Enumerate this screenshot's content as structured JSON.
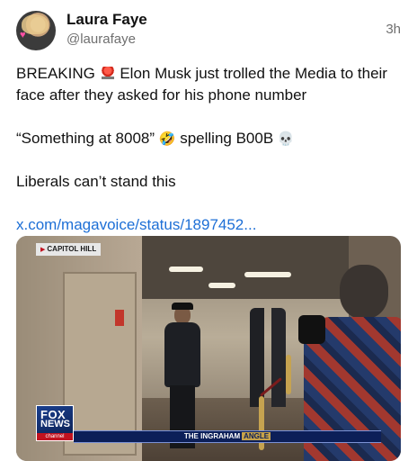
{
  "author": {
    "name": "Laura Faye",
    "handle": "@laurafaye",
    "time": "3h",
    "avatar_icon": "profile-photo"
  },
  "post": {
    "line1_prefix": "BREAKING",
    "line1_rest": "Elon Musk just trolled the Media to their face after they asked for his phone number",
    "line2": "“Something at 8008”",
    "line2_rest": "spelling B00B",
    "line3": "Liberals can’t stand this",
    "link": "x.com/magavoice/status/1897452..."
  },
  "media": {
    "location_tag": "CAPITOL HILL",
    "network_top": "FOX",
    "network_bottom": "NEWS",
    "network_sub": "channel",
    "show_name": "THE INGRAHAM",
    "show_accent": "ANGLE"
  },
  "colors": {
    "link": "#1d6fd6",
    "accent_red": "#c1121f",
    "navy": "#0c1f58"
  }
}
